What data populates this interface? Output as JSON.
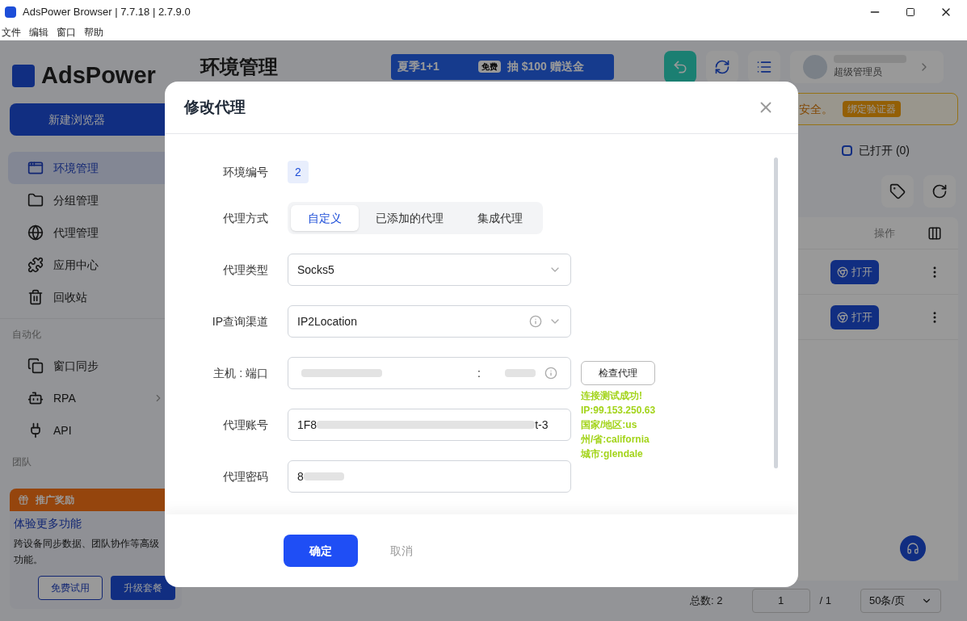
{
  "window": {
    "title": "AdsPower Browser | 7.7.18 | 2.7.9.0"
  },
  "menu": [
    "文件",
    "编辑",
    "窗口",
    "帮助"
  ],
  "sidebar": {
    "brand": "AdsPower",
    "new_button": "新建浏览器",
    "items": [
      {
        "label": "环境管理",
        "selected": true
      },
      {
        "label": "分组管理",
        "selected": false
      },
      {
        "label": "代理管理",
        "selected": false
      },
      {
        "label": "应用中心",
        "selected": false
      },
      {
        "label": "回收站",
        "selected": false
      }
    ],
    "sections": [
      {
        "title": "自动化",
        "items": [
          {
            "label": "窗口同步",
            "has_submenu": false
          },
          {
            "label": "RPA",
            "has_submenu": true
          },
          {
            "label": "API",
            "has_submenu": false
          }
        ]
      },
      {
        "title": "团队"
      }
    ],
    "promo": {
      "header": "推广奖励",
      "title": "体验更多功能",
      "text": "跨设备同步数据、团队协作等高级功能。",
      "buttons": [
        "免费试用",
        "升级套餐"
      ]
    }
  },
  "header": {
    "title": "环境管理",
    "banner": {
      "left": "夏季1+1",
      "badge": "免费",
      "right": "抽 $100 赠送金"
    },
    "user_role": "超级管理员"
  },
  "alert": {
    "text": "安全。",
    "button": "绑定验证器"
  },
  "filter": {
    "label": "已打开 (0)",
    "checked": false
  },
  "table": {
    "action_column": "操作",
    "rows": [
      {
        "button": "打开"
      },
      {
        "button": "打开"
      }
    ]
  },
  "pagination": {
    "total": "总数: 2",
    "page": "1",
    "pages": "/ 1",
    "page_size": "50条/页"
  },
  "dialog": {
    "title": "修改代理",
    "env_label": "环境编号",
    "env_id": "2",
    "mode_label": "代理方式",
    "modes": [
      {
        "label": "自定义",
        "selected": true
      },
      {
        "label": "已添加的代理",
        "selected": false
      },
      {
        "label": "集成代理",
        "selected": false
      }
    ],
    "fields": [
      {
        "kind": "select",
        "label": "代理类型",
        "value": "Socks5",
        "info": false
      },
      {
        "kind": "select",
        "label": "IP查询渠道",
        "value": "IP2Location",
        "info": true
      },
      {
        "kind": "hostport",
        "label": "主机 : 端口",
        "separator": ":",
        "info": true
      },
      {
        "kind": "masked",
        "label": "代理账号",
        "prefix": "1F8",
        "suffix": "t-3"
      },
      {
        "kind": "masked",
        "label": "代理密码",
        "prefix": "8"
      }
    ],
    "check_button": "检查代理",
    "check_result": [
      "连接测试成功!",
      "IP:99.153.250.63",
      "国家/地区:us",
      "州/省:california",
      "城市:glendale"
    ],
    "ok": "确定",
    "cancel": "取消"
  }
}
